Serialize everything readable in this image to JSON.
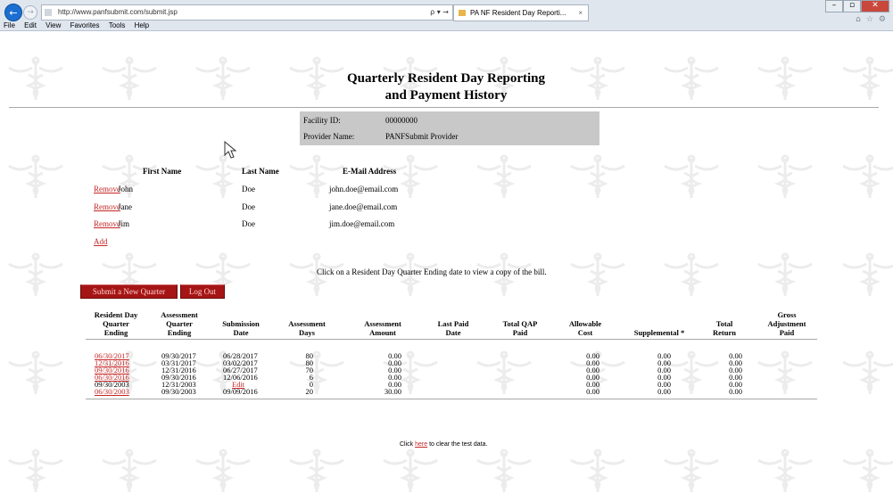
{
  "browser": {
    "url": "http://www.panfsubmit.com/submit.jsp",
    "address_tools": "ρ ▾ →",
    "tab_title": "PA NF Resident Day Reporti...",
    "tab_close": "×",
    "menu": [
      "File",
      "Edit",
      "View",
      "Favorites",
      "Tools",
      "Help"
    ],
    "win_min": "–",
    "win_max": "▫",
    "win_close": "✕",
    "tool_icons": [
      "home-icon",
      "star-icon",
      "gear-icon"
    ]
  },
  "page": {
    "title_line1": "Quarterly Resident Day Reporting",
    "title_line2": "and Payment History"
  },
  "facility": {
    "id_label": "Facility ID:",
    "id_value": "00000000",
    "provider_label": "Provider Name:",
    "provider_value": "PANFSubmit Provider"
  },
  "contacts": {
    "headers": {
      "first": "First Name",
      "last": "Last Name",
      "email": "E-Mail Address"
    },
    "rows": [
      {
        "action": "Remove",
        "first": "John",
        "last": "Doe",
        "email": "john.doe@email.com"
      },
      {
        "action": "Remove",
        "first": "Jane",
        "last": "Doe",
        "email": "jane.doe@email.com"
      },
      {
        "action": "Remove",
        "first": "Jim",
        "last": "Doe",
        "email": "jim.doe@email.com"
      }
    ],
    "add_label": "Add"
  },
  "instructions": "Click on a Resident Day Quarter Ending date to view a copy of the bill.",
  "buttons": {
    "submit_new": "Submit a New Quarter",
    "logout": "Log Out"
  },
  "history": {
    "headers": [
      "Resident Day\nQuarter\nEnding",
      "Assessment\nQuarter\nEnding",
      "Submission\nDate",
      "Assessment\nDays",
      "Assessment\nAmount",
      "Last Paid\nDate",
      "Total QAP\nPaid",
      "Allowable\nCost",
      "Supplemental *",
      "Total\nReturn",
      "Gross\nAdjustment\nPaid"
    ],
    "rows": [
      {
        "rd": "06/30/2017",
        "aq": "09/30/2017",
        "sub": "06/28/2017",
        "days": "80",
        "amt": "0.00",
        "paid": "",
        "qap": "",
        "allow": "0.00",
        "supp": "0.00",
        "ret": "0.00",
        "gross": ""
      },
      {
        "rd": "12/31/2016",
        "aq": "03/31/2017",
        "sub": "03/02/2017",
        "days": "80",
        "amt": "0.00",
        "paid": "",
        "qap": "",
        "allow": "0.00",
        "supp": "0.00",
        "ret": "0.00",
        "gross": ""
      },
      {
        "rd": "09/30/2016",
        "aq": "12/31/2016",
        "sub": "06/27/2017",
        "days": "70",
        "amt": "0.00",
        "paid": "",
        "qap": "",
        "allow": "0.00",
        "supp": "0.00",
        "ret": "0.00",
        "gross": ""
      },
      {
        "rd": "06/30/2016",
        "aq": "09/30/2016",
        "sub": "12/06/2016",
        "days": "6",
        "amt": "0.00",
        "paid": "",
        "qap": "",
        "allow": "0.00",
        "supp": "0.00",
        "ret": "0.00",
        "gross": ""
      },
      {
        "rd": "09/30/2003",
        "aq": "12/31/2003",
        "sub": "Edit",
        "days": "0",
        "amt": "0.00",
        "paid": "",
        "qap": "",
        "allow": "0.00",
        "supp": "0.00",
        "ret": "0.00",
        "gross": ""
      },
      {
        "rd": "06/30/2003",
        "aq": "09/30/2003",
        "sub": "09/09/2016",
        "days": "20",
        "amt": "30.00",
        "paid": "",
        "qap": "",
        "allow": "0.00",
        "supp": "0.00",
        "ret": "0.00",
        "gross": ""
      }
    ]
  },
  "footer": {
    "pre": "Click ",
    "link": "here",
    "post": " to clear the test data."
  },
  "colors": {
    "link_red": "#c62828",
    "button_red": "#a51515",
    "facility_bg": "#c8c8c8"
  }
}
